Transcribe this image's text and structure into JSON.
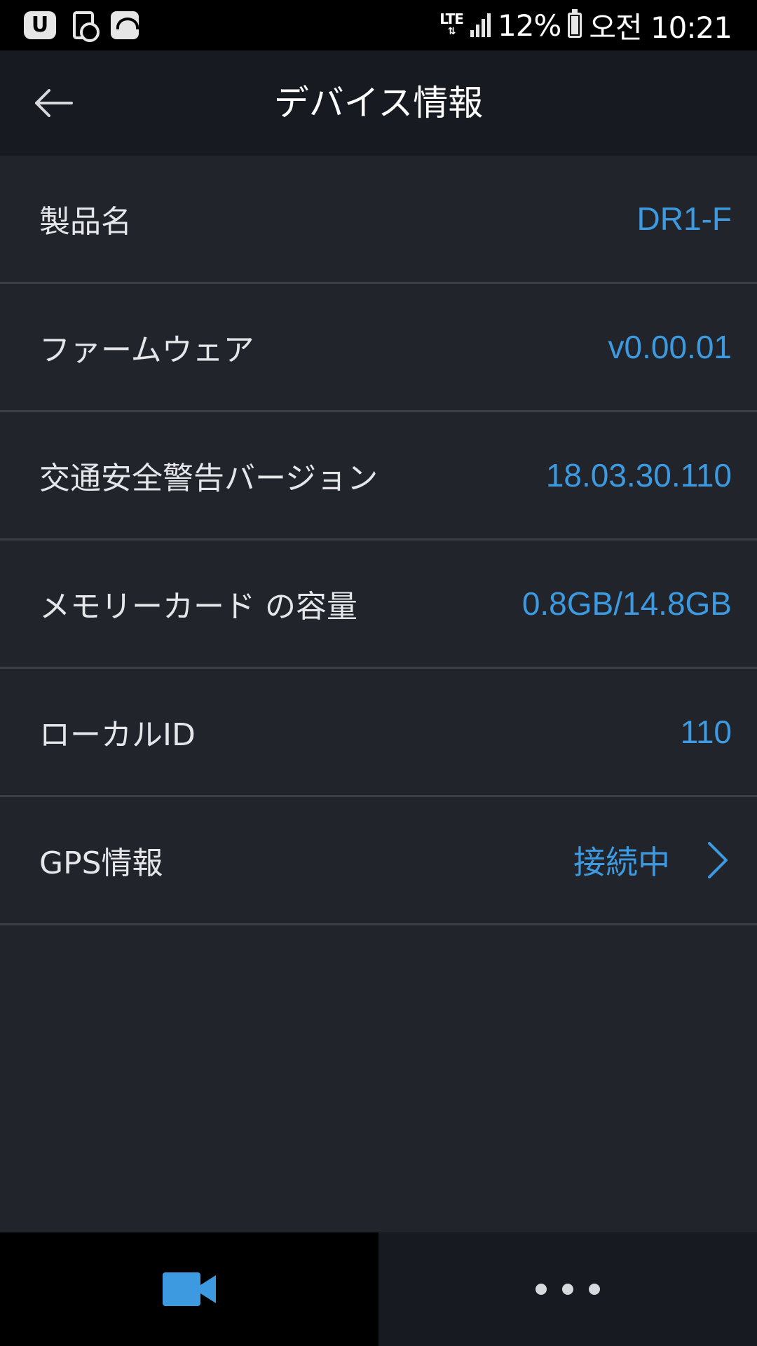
{
  "status_bar": {
    "network": "LTE",
    "battery_percent": "12%",
    "time": "오전 10:21",
    "icons": [
      "u-plus-icon",
      "phone-lock-icon",
      "wifi-box-icon",
      "lte-icon",
      "signal-icon",
      "battery-charging-icon"
    ]
  },
  "header": {
    "title": "デバイス情報",
    "back_icon": "arrow-left-icon"
  },
  "info": {
    "rows": [
      {
        "label": "製品名",
        "value": "DR1-F"
      },
      {
        "label": "ファームウェア",
        "value": "v0.00.01"
      },
      {
        "label": "交通安全警告バージョン",
        "value": "18.03.30.110"
      },
      {
        "label": "メモリーカード の容量",
        "value": "0.8GB/14.8GB"
      },
      {
        "label": "ローカルID",
        "value": "110"
      },
      {
        "label": "GPS情報",
        "value": "接続中",
        "icon": "chevron-right-icon"
      }
    ]
  },
  "bottom_nav": {
    "tabs": [
      {
        "icon": "video-camera-icon",
        "active": true
      },
      {
        "icon": "more-dots-icon",
        "active": false
      }
    ]
  },
  "colors": {
    "background": "#21242b",
    "header": "#171a21",
    "accent": "#3d9ae0",
    "divider": "#3a3e46",
    "label": "#e4e6ea"
  }
}
